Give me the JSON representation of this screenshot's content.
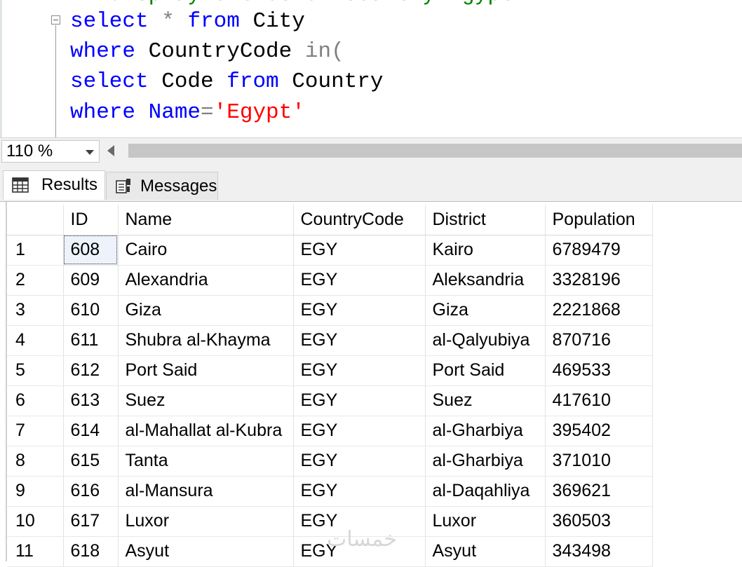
{
  "editor": {
    "partial_line": "-- display cities of country Egypt",
    "lines": {
      "l1": {
        "kw1": "select",
        "op": " * ",
        "kw2": "from",
        "rest": " City"
      },
      "l2": {
        "kw": "where",
        "rest": " CountryCode ",
        "fn": "in",
        "paren": "("
      },
      "l3": {
        "kw1": "select",
        "mid": " Code ",
        "kw2": "from",
        "rest": " Country"
      },
      "l4": {
        "kw": "where",
        "rest": " Name",
        "op": "=",
        "str": "'Egypt'"
      }
    }
  },
  "zoom": {
    "value": "110 %"
  },
  "tabs": {
    "results_label": "Results",
    "messages_label": "Messages"
  },
  "grid": {
    "columns": [
      "ID",
      "Name",
      "CountryCode",
      "District",
      "Population"
    ],
    "rows": [
      {
        "n": "1",
        "id": "608",
        "name": "Cairo",
        "cc": "EGY",
        "district": "Kairo",
        "pop": "6789479"
      },
      {
        "n": "2",
        "id": "609",
        "name": "Alexandria",
        "cc": "EGY",
        "district": "Aleksandria",
        "pop": "3328196"
      },
      {
        "n": "3",
        "id": "610",
        "name": "Giza",
        "cc": "EGY",
        "district": "Giza",
        "pop": "2221868"
      },
      {
        "n": "4",
        "id": "611",
        "name": "Shubra al-Khayma",
        "cc": "EGY",
        "district": "al-Qalyubiya",
        "pop": "870716"
      },
      {
        "n": "5",
        "id": "612",
        "name": "Port Said",
        "cc": "EGY",
        "district": "Port Said",
        "pop": "469533"
      },
      {
        "n": "6",
        "id": "613",
        "name": "Suez",
        "cc": "EGY",
        "district": "Suez",
        "pop": "417610"
      },
      {
        "n": "7",
        "id": "614",
        "name": "al-Mahallat al-Kubra",
        "cc": "EGY",
        "district": "al-Gharbiya",
        "pop": "395402"
      },
      {
        "n": "8",
        "id": "615",
        "name": "Tanta",
        "cc": "EGY",
        "district": "al-Gharbiya",
        "pop": "371010"
      },
      {
        "n": "9",
        "id": "616",
        "name": "al-Mansura",
        "cc": "EGY",
        "district": "al-Daqahliya",
        "pop": "369621"
      },
      {
        "n": "10",
        "id": "617",
        "name": "Luxor",
        "cc": "EGY",
        "district": "Luxor",
        "pop": "360503"
      },
      {
        "n": "11",
        "id": "618",
        "name": "Asyut",
        "cc": "EGY",
        "district": "Asyut",
        "pop": "343498"
      }
    ]
  },
  "watermark": "خمسات",
  "icons": {
    "results": "grid-icon",
    "messages": "messages-icon",
    "fold": "collapse-icon"
  }
}
